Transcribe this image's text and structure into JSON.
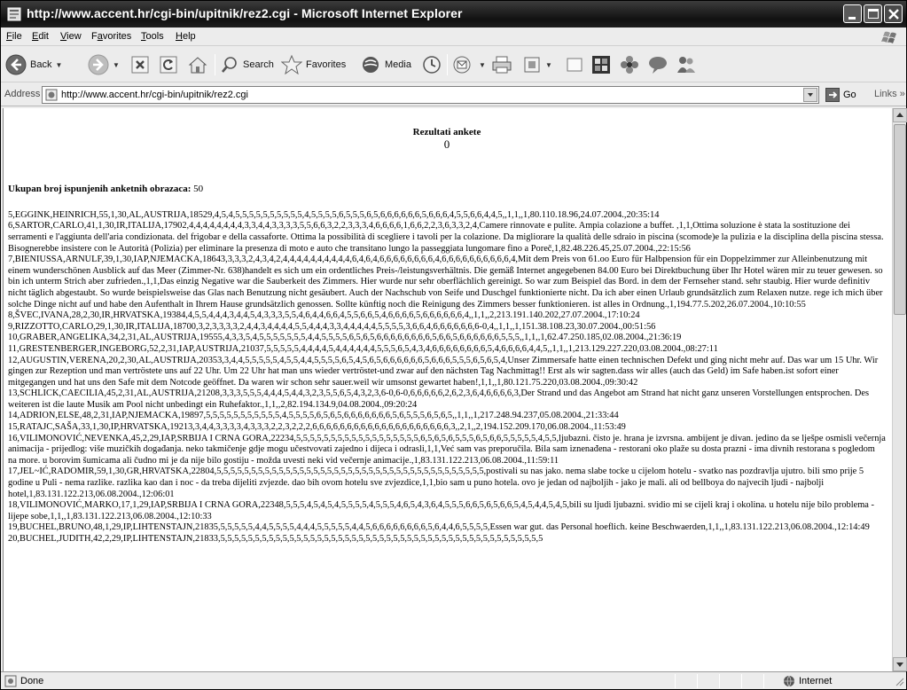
{
  "window": {
    "title": "http://www.accent.hr/cgi-bin/upitnik/rez2.cgi - Microsoft Internet Explorer"
  },
  "menu": {
    "items": [
      {
        "u": "F",
        "rest": "ile"
      },
      {
        "u": "E",
        "rest": "dit"
      },
      {
        "u": "V",
        "rest": "iew"
      },
      {
        "pre": "F",
        "u": "a",
        "rest": "vorites"
      },
      {
        "u": "T",
        "rest": "ools"
      },
      {
        "u": "H",
        "rest": "elp"
      }
    ]
  },
  "toolbar": {
    "back": "Back",
    "search": "Search",
    "favorites": "Favorites",
    "media": "Media"
  },
  "address": {
    "label": "Address",
    "url": "http://www.accent.hr/cgi-bin/upitnik/rez2.cgi",
    "go": "Go",
    "links": "Links"
  },
  "page": {
    "title": "Rezultati ankete",
    "counter": "0",
    "total_label": "Ukupan broj ispunjenih anketnih obrazaca:",
    "total_value": "50",
    "records": [
      "5,EGGINK,HEINRICH,55,1,30,AL,AUSTRIJA,18529,4,5,4,5,5,5,5,5,5,5,5,5,5,4,5,5,5,5,6,5,5,5,6,5,6,6,6,6,6,6,5,6,6,6,4,5,5,6,6,4,4,5,,1,1,,1,80.110.18.96,24.07.2004.,20:35:14",
      "6,SARTOR,CARLO,41,1,30,IR,ITALIJA,17902,4,4,4,4,4,4,4,4,3,3,4,4,3,3,3,3,5,5,6,6,3,2,2,3,3,3,4,6,6,6,6,1,6,6,2,2,3,6,3,3,2,4,Camere rinnovate e pulite. Ampia colazione a buffet. ,1,1,Ottima soluzione è stata la sostituzione dei serramenti e l'aggiunta dell'aria condizionata. del frigobar e della cassaforte. Ottima la possibilità di scegliere i tavoli per la colazione. Da migliorare la qualità delle sdraio in piscina (scomode)e la pulizia e la disciplina della piscina stessa. Bisognerebbe insistere con le Autorità (Polizia) per eliminare la presenza di moto e auto che transitano lungo la passeggiata lungomare fino a Poreč,1,82.48.226.45,25.07.2004.,22:15:56",
      "7,BIENIUSSA,ARNULF,39,1,30,IAP,NJEMACKA,18643,3,3,3,2,4,3,4,2,4,4,4,4,4,4,4,4,4,4,6,4,6,4,6,6,6,6,6,6,6,6,4,6,6,6,6,6,6,6,6,6,6,4,Mit dem Preis von 61.oo Euro für Halbpension für ein Doppelzimmer zur Alleinbenutzung mit einem wunderschönen Ausblick auf das Meer (Zimmer-Nr. 638)handelt es sich um ein ordentliches Preis-/leistungsverhältnis. Die gemäß Internet angegebenen 84.00 Euro bei Direktbuchung über Ihr Hotel wären mir zu teuer gewesen. so bin ich unterm Strich aber zufrieden.,1,1,Das einzig Negative war die Sauberkeit des Zimmers. Hier wurde nur sehr oberflächlich gereinigt. So war zum Beispiel das Bord. in dem der Fernseher stand. sehr staubig. Hier wurde definitiv nicht täglich abgestaubt. So wurde beispielsweise das Glas nach Benutzung nicht gesäubert. Auch der Nachschub von Seife und Duschgel funktionierte nicht. Da ich aber einen Urlaub grundsätzlich zum Relaxen nutze. rege ich mich über solche Dinge nicht auf und habe den Aufenthalt in Ihrem Hause grundsätzlich genossen. Sollte künftig noch die Reinigung des Zimmers besser funktionieren. ist alles in Ordnung.,1,194.77.5.202,26.07.2004.,10:10:55",
      "8,ŠVEC,IVANA,28,2,30,IR,HRVATSKA,19384,4,5,5,4,4,4,3,4,4,5,4,3,3,3,5,5,4,6,4,4,6,6,4,5,5,6,6,5,4,6,6,6,6,5,6,6,6,6,6,6,4,,1,1,,2,213.191.140.202,27.07.2004.,17:10:24",
      "9,RIZZOTTO,CARLO,29,1,30,IR,ITALIJA,18700,3,2,3,3,3,3,2,4,4,3,4,4,4,4,5,5,4,4,4,3,3,4,4,4,4,4,5,5,5,5,3,6,6,4,6,6,6,6,6,6,6-0,4,,1,1,,1,151.38.108.23,30.07.2004.,00:51:56",
      "10,GRABER,ANGELIKA,34,2,31,AL,AUSTRIJA,19555,4,3,3,5,4,5,5,5,5,5,5,5,4,4,5,5,5,5,6,5,6,5,6,6,6,6,6,6,6,6,5,6,6,5,6,6,6,6,6,6,5,5,5,,1,1,,1,62.47.250.185,02.08.2004.,21:36:19",
      "11,GRESTENBERGER,INGEBORG,52,2,31,IAP,AUSTRIJA,21037,5,5,5,5,5,4,4,4,4,5,4,4,4,4,4,4,5,5,5,6,5,4,3,4,6,6,6,6,6,6,6,6,5,4,6,6,6,6,4,4,5,,1,1,,1,213.129.227.220,03.08.2004.,08:27:11",
      "12,AUGUSTIN,VERENA,20,2,30,AL,AUSTRIJA,20353,3,4,4,5,5,5,5,5,4,5,5,4,4,5,5,5,5,6,5,4,5,6,5,6,6,6,6,6,6,5,6,6,6,5,5,5,6,5,6,5,4,Unser Zimmersafe hatte einen technischen Defekt und ging nicht mehr auf. Das war um 15 Uhr. Wir gingen zur Rezeption und man vertröstete uns auf 22 Uhr. Um 22 Uhr hat man uns wieder vertröstet-und zwar auf den nächsten Tag Nachmittag!! Erst als wir sagten.dass wir alles (auch das Geld) im Safe haben.ist sofort einer mitgegangen und hat uns den Safe mit dem Notcode geöffnet. Da waren wir schon sehr sauer.weil wir umsonst gewartet haben!,1,1,,1,80.121.75.220,03.08.2004.,09:30:42",
      "13,SCHLICK,CAECILIA,45,2,31,AL,AUSTRIJA,21208,3,3,3,5,5,5,4,4,4,5,4,4,3,2,3,5,5,6,5,4,3,2,3,6-0,6-0,6,6,6,6,6,2,6,2,3,6,4,6,6,6,6,3,Der Strand und das Angebot am Strand hat nicht ganz unseren Vorstellungen entsprochen. Des weiteren ist die laute Musik am Pool nicht unbedingt ein Ruhefaktor.,1,1,,2,82.194.134.9,04.08.2004.,09:20:24",
      "14,ADRION,ELSE,48,2,31,IAP,NJEMACKA,19897,5,5,5,5,5,5,5,5,5,5,5,4,5,5,5,5,6,5,6,5,6,6,6,6,6,6,6,5,6,5,5,5,6,5,6,5,,1,1,,1,217.248.94.237,05.08.2004.,21:33:44",
      "15,RATAJC,SAŠA,33,1,30,IP,HRVATSKA,19213,3,4,4,3,3,3,3,4,3,3,3,2,2,3,2,2,2,6,6,6,6,6,6,6,6,6,6,6,6,6,6,6,6,6,6,6,6,3,,2,1,,2,194.152.209.170,06.08.2004.,11:53:49",
      "16,VILIMONOVIĆ,NEVENKA,45,2,29,IAP,SRBIJA I CRNA GORA,22234,5,5,5,5,5,5,5,5,5,5,5,5,5,5,5,5,5,5,6,5,6,5,6,5,5,5,6,5,6,6,5,5,5,5,5,4,5,5,ljubazni. čisto je. hrana je izvrsna. ambijent je divan. jedino da se lješpe osmisli večernja animacija - prijedlog: više muzičkih događanja. neko takmičenje gdje mogu učestvovati zajedno i dijeca i odrasli,1,1,Već sam vas preporučila. Bila sam iznenađena - restorani oko plaže su dosta prazni - ima divnih restorana s pogledom na more. u borovim šumicama ali čudno mi je da nije bilo gostiju - možda uvesti neki vid večernje animacije.,1,83.131.122.213,06.08.2004.,11:59:11",
      "17,JEL~IĆ,RADOMIR,59,1,30,GR,HRVATSKA,22804,5,5,5,5,5,5,5,5,5,5,5,5,5,5,5,5,5,5,5,5,5,5,5,5,5,5,5,5,5,5,5,5,5,5,5,5,5,5,5,postivali su nas jako. nema slabe tocke u cijelom hotelu - svatko nas pozdravlja ujutro. bili smo prije 5 godine u Puli - nema razlike. razlika kao dan i noc - da treba dijeliti zvjezde. dao bih ovom hotelu sve zvjezdice,1,1,bio sam u puno hotela. ovo je jedan od najboljih - jako je mali. ali od bellboya do najvecih ljudi - najbolji hotel,1,83.131.122.213,06.08.2004.,12:06:01",
      "18,VILIMONOVIĆ,MARKO,17,1,29,IAP,SRBIJA I CRNA GORA,22348,5,5,5,4,5,4,5,4,5,5,5,5,4,5,5,5,4,6,5,4,3,6,4,5,5,5,6,6,5,6,5,6,6,5,4,5,4,4,5,4,5,bili su ljudi ljubazni. svidio mi se cijeli kraj i okolina. u hotelu nije bilo problema - lijepe sobe,1,1,,1,83.131.122.213,06.08.2004.,12:10:33",
      "19,BUCHEL,BRUNO,48,1,29,IP,LIHTENSTAJN,21835,5,5,5,5,5,4,4,5,5,5,5,4,4,4,5,5,5,5,5,4,4,5,6,6,6,6,6,6,6,6,5,6,4,4,6,5,5,5,5,Essen war gut. das Personal hoeflich. keine Beschwaerden,1,1,,1,83.131.122.213,06.08.2004.,12:14:49",
      "20,BUCHEL,JUDITH,42,2,29,IP,LIHTENSTAJN,21833,5,5,5,5,5,5,5,5,5,5,5,5,5,5,5,5,5,5,5,5,5,5,5,5,5,5,5,5,5,5,5,5,5,5,5,5,5,5,5,5,5,5,5,5,5,5,5"
    ]
  },
  "status": {
    "text": "Done",
    "zone": "Internet"
  }
}
